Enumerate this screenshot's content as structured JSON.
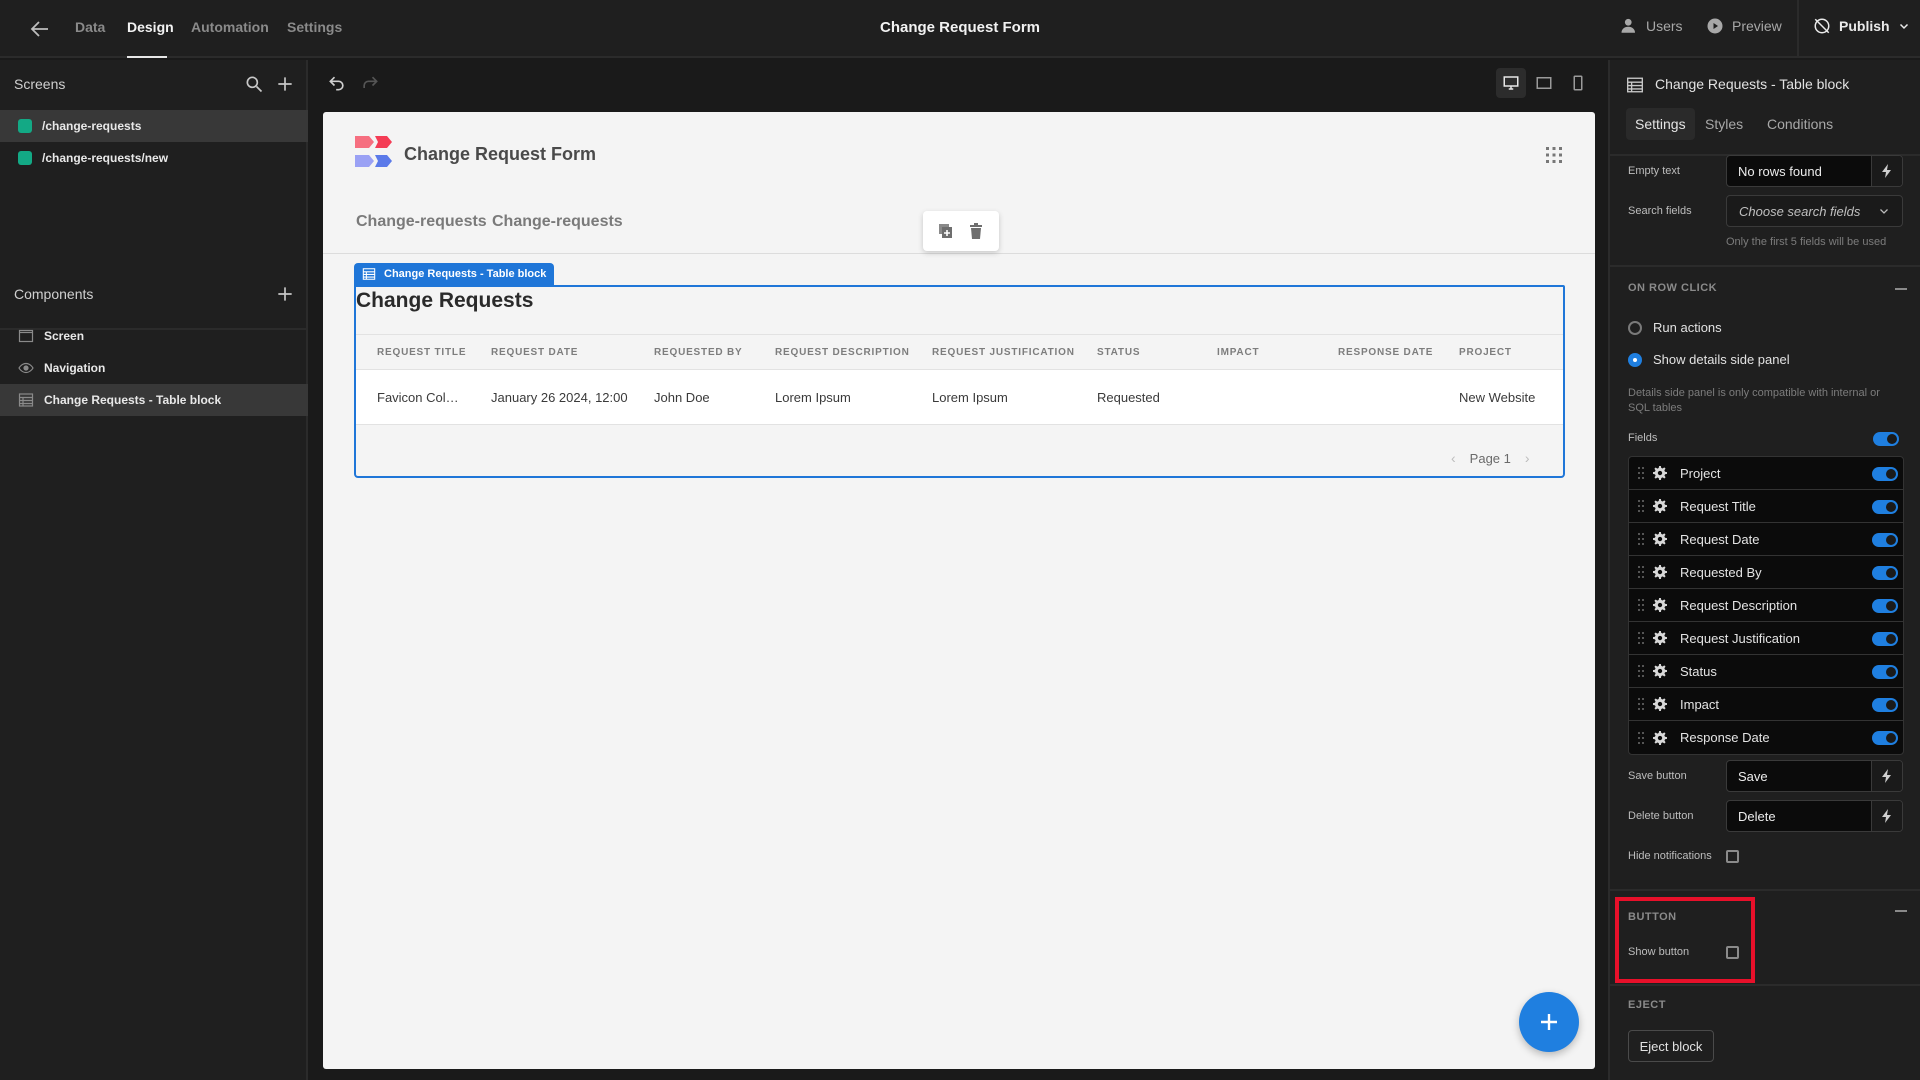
{
  "topbar": {
    "tabs": [
      {
        "label": "Data",
        "active": false
      },
      {
        "label": "Design",
        "active": true
      },
      {
        "label": "Automation",
        "active": false
      },
      {
        "label": "Settings",
        "active": false
      }
    ],
    "title": "Change Request Form",
    "users_label": "Users",
    "preview_label": "Preview",
    "publish_label": "Publish"
  },
  "sidebar": {
    "screens_heading": "Screens",
    "screens": [
      {
        "route": "/change-requests",
        "selected": true,
        "color": "#13a985"
      },
      {
        "route": "/change-requests/new",
        "selected": false,
        "color": "#13a985"
      }
    ],
    "components_heading": "Components",
    "components": [
      {
        "label": "Screen",
        "icon": "screen-icon",
        "selected": false
      },
      {
        "label": "Navigation",
        "icon": "eye-icon",
        "selected": false
      },
      {
        "label": "Change Requests - Table block",
        "icon": "table-icon",
        "selected": true
      }
    ]
  },
  "canvas": {
    "device_modes": [
      "desktop",
      "tablet",
      "mobile"
    ],
    "active_device": "desktop",
    "app": {
      "name": "Change Request Form",
      "nav_links": [
        "Change-requests",
        "Change-requests"
      ]
    },
    "block_tag": "Change Requests - Table block",
    "table": {
      "title": "Change Requests",
      "columns": [
        "Request Title",
        "Request Date",
        "Requested By",
        "Request Description",
        "Request Justification",
        "Status",
        "Impact",
        "Response Date",
        "Project"
      ],
      "rows": [
        [
          "Favicon Col…",
          "January 26 2024, 12:00",
          "John Doe",
          "Lorem Ipsum",
          "Lorem Ipsum",
          "Requested",
          "",
          "",
          "New Website"
        ]
      ],
      "page_label": "Page 1"
    }
  },
  "settings_panel": {
    "title": "Change Requests - Table block",
    "tabs": [
      {
        "label": "Settings",
        "active": true
      },
      {
        "label": "Styles",
        "active": false
      },
      {
        "label": "Conditions",
        "active": false
      }
    ],
    "empty_text_label": "Empty text",
    "empty_text_value": "No rows found",
    "search_fields_label": "Search fields",
    "search_fields_placeholder": "Choose search fields",
    "search_fields_hint": "Only the first 5 fields will be used",
    "on_row_click": {
      "heading": "ON ROW CLICK",
      "options": [
        {
          "label": "Run actions",
          "selected": false
        },
        {
          "label": "Show details side panel",
          "selected": true
        }
      ],
      "hint": "Details side panel is only compatible with internal or SQL tables",
      "fields_label": "Fields",
      "fields_enabled": true,
      "fields": [
        {
          "name": "Project",
          "enabled": true
        },
        {
          "name": "Request Title",
          "enabled": true
        },
        {
          "name": "Request Date",
          "enabled": true
        },
        {
          "name": "Requested By",
          "enabled": true
        },
        {
          "name": "Request Description",
          "enabled": true
        },
        {
          "name": "Request Justification",
          "enabled": true
        },
        {
          "name": "Status",
          "enabled": true
        },
        {
          "name": "Impact",
          "enabled": true
        },
        {
          "name": "Response Date",
          "enabled": true
        }
      ],
      "save_button_label": "Save button",
      "save_button_value": "Save",
      "delete_button_label": "Delete button",
      "delete_button_value": "Delete",
      "hide_notifications_label": "Hide notifications",
      "hide_notifications_checked": false
    },
    "button_section": {
      "heading": "BUTTON",
      "show_button_label": "Show button",
      "show_button_checked": false
    },
    "eject_section": {
      "heading": "EJECT",
      "eject_label": "Eject block"
    }
  },
  "colors": {
    "accent": "#1f76d8",
    "screen_dot": "#13a985",
    "highlight": "#e8102a"
  }
}
